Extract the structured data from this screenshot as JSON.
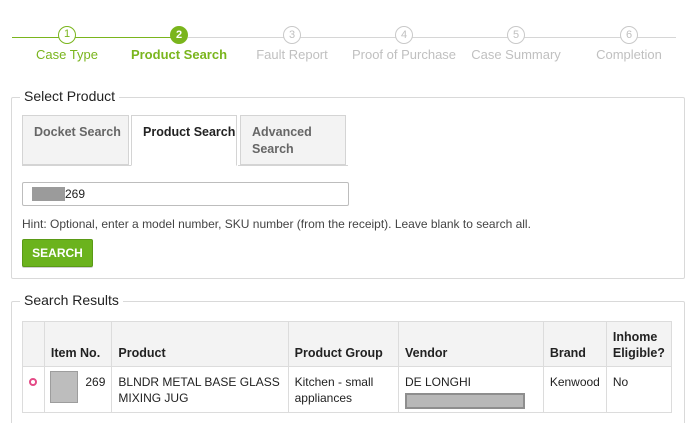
{
  "stepper": {
    "steps": [
      {
        "number": "1",
        "label": "Case Type",
        "state": "done"
      },
      {
        "number": "2",
        "label": "Product Search",
        "state": "active"
      },
      {
        "number": "3",
        "label": "Fault Report",
        "state": "todo"
      },
      {
        "number": "4",
        "label": "Proof of Purchase",
        "state": "todo"
      },
      {
        "number": "5",
        "label": "Case Summary",
        "state": "todo"
      },
      {
        "number": "6",
        "label": "Completion",
        "state": "todo"
      }
    ]
  },
  "select_product": {
    "legend": "Select Product",
    "tabs": [
      {
        "label": "Docket Search",
        "active": false
      },
      {
        "label": "Product Search",
        "active": true
      },
      {
        "label": "Advanced Search",
        "active": false
      }
    ],
    "search_value": "269",
    "hint": "Hint: Optional, enter a model number, SKU number (from the receipt). Leave blank to search all.",
    "search_button": "SEARCH"
  },
  "search_results": {
    "legend": "Search Results",
    "columns": [
      "",
      "Item No.",
      "Product",
      "Product Group",
      "Vendor",
      "Brand",
      "Inhome Eligible?"
    ],
    "rows": [
      {
        "item_no": "269",
        "product": "BLNDR METAL BASE GLASS MIXING JUG",
        "product_group": "Kitchen - small appliances",
        "vendor": "DE LONGHI",
        "brand": "Kenwood",
        "inhome_eligible": "No"
      }
    ]
  },
  "colors": {
    "accent": "#7ab51d",
    "button": "#6bb31d",
    "radio": "#e44a86",
    "inactive_step": "#c0c0c0"
  }
}
